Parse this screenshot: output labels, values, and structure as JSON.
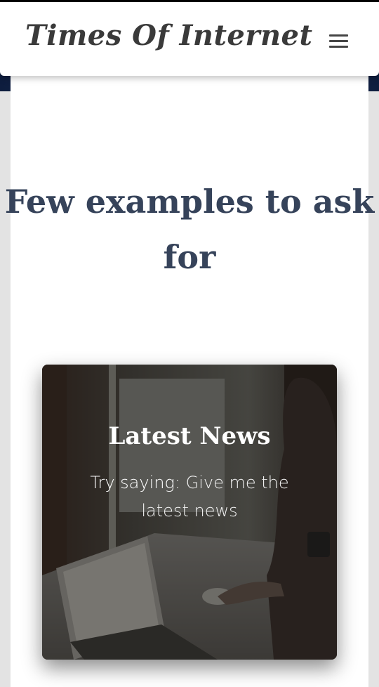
{
  "header": {
    "brand": "Times Of Internet",
    "menu_icon": "hamburger-menu-icon"
  },
  "main": {
    "heading": "Few examples to ask for"
  },
  "example_card": {
    "title": "Latest News",
    "prefix": "Try saying:",
    "text": "Give me the latest news"
  },
  "colors": {
    "heading": "#36435a",
    "brand": "#3a3a3a",
    "band": "#0e1d3e"
  }
}
